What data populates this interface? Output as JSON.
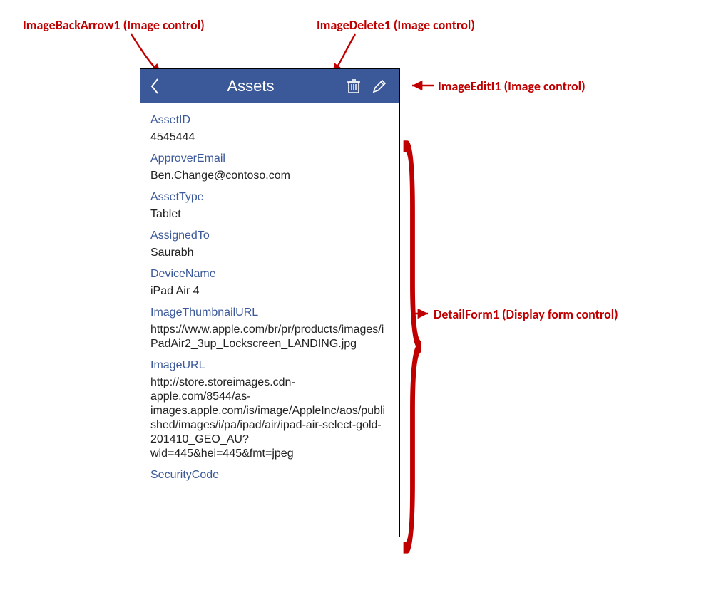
{
  "annotations": {
    "backArrow": "ImageBackArrow1 (Image control)",
    "delete": "ImageDelete1 (Image control)",
    "edit": "ImageEditI1 (Image control)",
    "detailForm": "DetailForm1 (Display form control)"
  },
  "header": {
    "title": "Assets"
  },
  "fields": [
    {
      "label": "AssetID",
      "value": "4545444"
    },
    {
      "label": "ApproverEmail",
      "value": "Ben.Change@contoso.com"
    },
    {
      "label": "AssetType",
      "value": "Tablet"
    },
    {
      "label": "AssignedTo",
      "value": "Saurabh"
    },
    {
      "label": "DeviceName",
      "value": "iPad Air 4"
    },
    {
      "label": "ImageThumbnailURL",
      "value": "https://www.apple.com/br/pr/products/images/iPadAir2_3up_Lockscreen_LANDING.jpg"
    },
    {
      "label": "ImageURL",
      "value": "http://store.storeimages.cdn-apple.com/8544/as-images.apple.com/is/image/AppleInc/aos/published/images/i/pa/ipad/air/ipad-air-select-gold-201410_GEO_AU?wid=445&hei=445&fmt=jpeg"
    },
    {
      "label": "SecurityCode",
      "value": ""
    }
  ],
  "colors": {
    "header": "#3B5998",
    "annotation": "#C00000"
  }
}
